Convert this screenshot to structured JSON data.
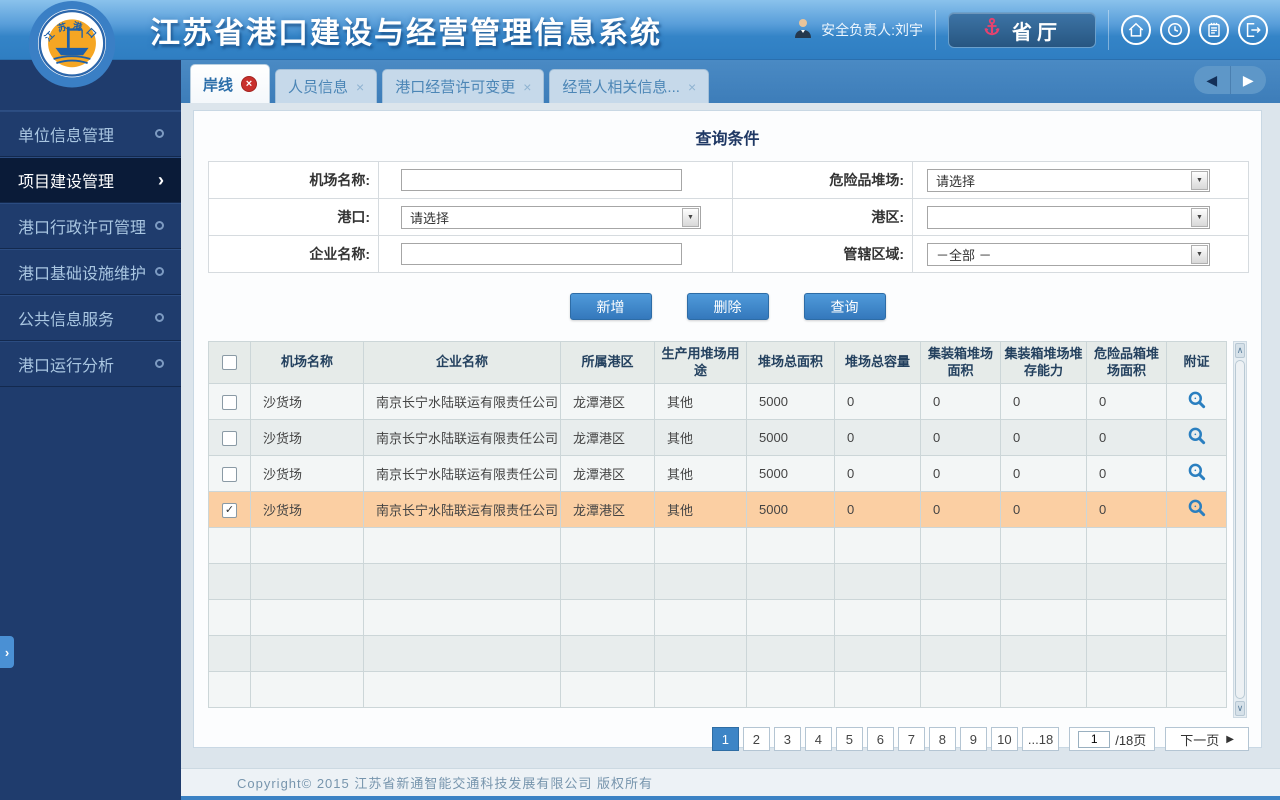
{
  "header": {
    "title": "江苏省港口建设与经营管理信息系统",
    "logo_text": "江苏港口",
    "user_label": "安全负责人:刘宇",
    "dept_button": "省厅",
    "nav_icons": [
      "home-icon",
      "clock-icon",
      "notes-icon",
      "logout-icon"
    ]
  },
  "tabs": [
    {
      "label": "岸线",
      "active": true
    },
    {
      "label": "人员信息",
      "active": false
    },
    {
      "label": "港口经营许可变更",
      "active": false
    },
    {
      "label": "经营人相关信息...",
      "active": false
    }
  ],
  "sidebar": {
    "items": [
      {
        "label": "单位信息管理",
        "active": false
      },
      {
        "label": "项目建设管理",
        "active": true
      },
      {
        "label": "港口行政许可管理",
        "active": false
      },
      {
        "label": "港口基础设施维护",
        "active": false
      },
      {
        "label": "公共信息服务",
        "active": false
      },
      {
        "label": "港口运行分析",
        "active": false
      }
    ]
  },
  "query": {
    "title": "查询条件",
    "rows": [
      [
        {
          "label": "机场名称:",
          "type": "text",
          "value": ""
        },
        {
          "label": "危险品堆场:",
          "type": "select",
          "value": "请选择"
        }
      ],
      [
        {
          "label": "港口:",
          "type": "select",
          "value": "请选择"
        },
        {
          "label": "港区:",
          "type": "select",
          "value": ""
        }
      ],
      [
        {
          "label": "企业名称:",
          "type": "text",
          "value": ""
        },
        {
          "label": "管辖区域:",
          "type": "select",
          "value": "－全部 －"
        }
      ]
    ],
    "buttons": [
      {
        "label": "新增",
        "name": "add-button"
      },
      {
        "label": "删除",
        "name": "delete-button"
      },
      {
        "label": "查询",
        "name": "search-button"
      }
    ]
  },
  "table": {
    "columns": [
      "机场名称",
      "企业名称",
      "所属港区",
      "生产用堆场用途",
      "堆场总面积",
      "堆场总容量",
      "集装箱堆场面积",
      "集装箱堆场堆存能力",
      "危险品箱堆场面积",
      "附证"
    ],
    "rows": [
      {
        "checked": false,
        "selected": false,
        "empty": false,
        "cells": [
          "沙货场",
          "南京长宁水陆联运有限责任公司",
          "龙潭港区",
          "其他",
          "5000",
          "0",
          "0",
          "0",
          "0"
        ],
        "attachment": true
      },
      {
        "checked": false,
        "selected": false,
        "empty": false,
        "cells": [
          "沙货场",
          "南京长宁水陆联运有限责任公司",
          "龙潭港区",
          "其他",
          "5000",
          "0",
          "0",
          "0",
          "0"
        ],
        "attachment": true
      },
      {
        "checked": false,
        "selected": false,
        "empty": false,
        "cells": [
          "沙货场",
          "南京长宁水陆联运有限责任公司",
          "龙潭港区",
          "其他",
          "5000",
          "0",
          "0",
          "0",
          "0"
        ],
        "attachment": true
      },
      {
        "checked": true,
        "selected": true,
        "empty": false,
        "cells": [
          "沙货场",
          "南京长宁水陆联运有限责任公司",
          "龙潭港区",
          "其他",
          "5000",
          "0",
          "0",
          "0",
          "0"
        ],
        "attachment": true
      },
      {
        "empty": true
      },
      {
        "empty": true
      },
      {
        "empty": true
      },
      {
        "empty": true
      },
      {
        "empty": true
      }
    ]
  },
  "pagination": {
    "pages": [
      "1",
      "2",
      "3",
      "4",
      "5",
      "6",
      "7",
      "8",
      "9",
      "10",
      "...18"
    ],
    "active_page": "1",
    "jump_value": "1",
    "page_total_label": "/18页",
    "next_label": "下一页"
  },
  "footer": {
    "copyright": "Copyright© 2015 江苏省新通智能交通科技发展有限公司 版权所有"
  },
  "icons": {
    "select-arrow": "▼",
    "chevron-right": "›",
    "close-active": "×",
    "close": "×",
    "back-arrow": "◀",
    "next-arrow": "▶",
    "check": "✓",
    "expand": "›",
    "scroll-up": "∧",
    "scroll-down": "∨"
  },
  "colors": {
    "accent_blue": "#3d85c6",
    "selected_row": "#fbcfa3",
    "tab_close_badge": "#c9302c",
    "anchor_pink": "#e8426e",
    "sidebar_navy": "#1f3c6d"
  }
}
